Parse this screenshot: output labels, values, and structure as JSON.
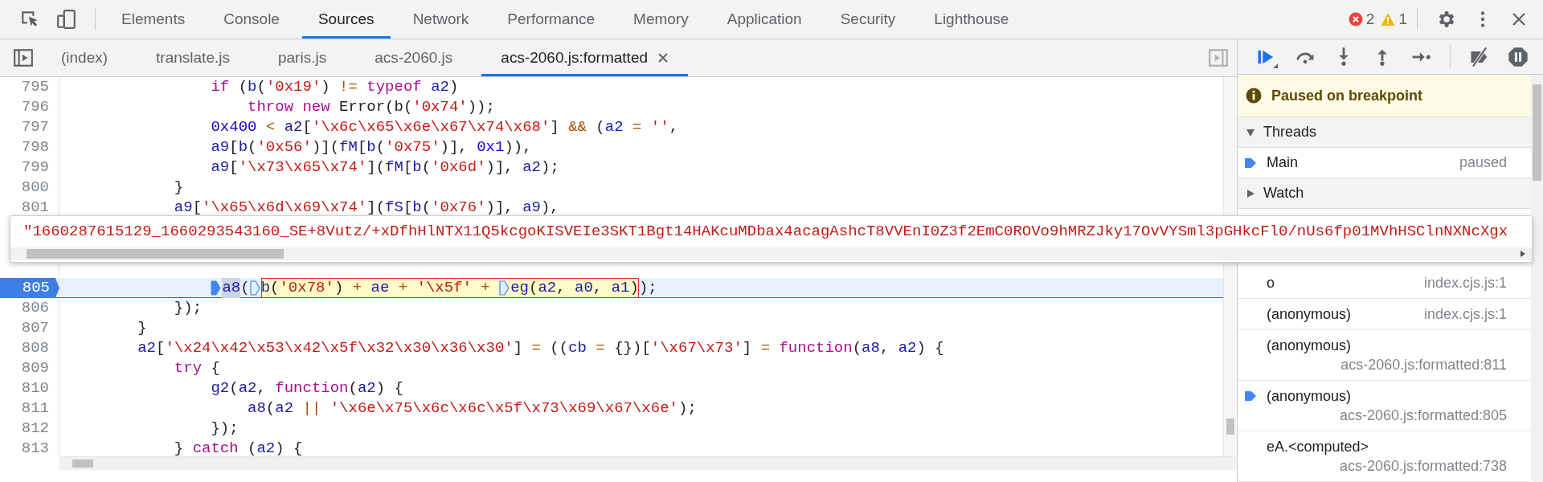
{
  "top_tabs": [
    {
      "label": "Elements",
      "selected": false
    },
    {
      "label": "Console",
      "selected": false
    },
    {
      "label": "Sources",
      "selected": true
    },
    {
      "label": "Network",
      "selected": false
    },
    {
      "label": "Performance",
      "selected": false
    },
    {
      "label": "Memory",
      "selected": false
    },
    {
      "label": "Application",
      "selected": false
    },
    {
      "label": "Security",
      "selected": false
    },
    {
      "label": "Lighthouse",
      "selected": false
    }
  ],
  "issue_counts": {
    "errors": "2",
    "warnings": "1"
  },
  "file_tabs": [
    {
      "label": "(index)",
      "selected": false,
      "closable": false
    },
    {
      "label": "translate.js",
      "selected": false,
      "closable": false
    },
    {
      "label": "paris.js",
      "selected": false,
      "closable": false
    },
    {
      "label": "acs-2060.js",
      "selected": false,
      "closable": false
    },
    {
      "label": "acs-2060.js:formatted",
      "selected": true,
      "closable": true
    }
  ],
  "code_before_popup": [
    {
      "number": "795",
      "current": false,
      "breakpoint": false,
      "tokens": [
        {
          "kind": "kw",
          "text": "                if"
        },
        {
          "kind": "p",
          "text": " ("
        },
        {
          "kind": "var",
          "text": "b"
        },
        {
          "kind": "p",
          "text": "("
        },
        {
          "kind": "str",
          "text": "'0x19'"
        },
        {
          "kind": "p",
          "text": ")"
        },
        {
          "kind": "op",
          "text": " != "
        },
        {
          "kind": "kw",
          "text": "typeof"
        },
        {
          "kind": "var",
          "text": " a2"
        },
        {
          "kind": "p",
          "text": ")"
        }
      ]
    },
    {
      "number": "796",
      "current": false,
      "breakpoint": false,
      "tokens": [
        {
          "kind": "kw",
          "text": "                    throw"
        },
        {
          "kind": "kw",
          "text": " new"
        },
        {
          "kind": "p",
          "text": " Error(b("
        },
        {
          "kind": "str",
          "text": "'0x74'"
        },
        {
          "kind": "p",
          "text": "));"
        }
      ]
    },
    {
      "number": "797",
      "current": false,
      "breakpoint": false,
      "tokens": [
        {
          "kind": "num",
          "text": "                0x400"
        },
        {
          "kind": "op",
          "text": " < "
        },
        {
          "kind": "var",
          "text": "a2"
        },
        {
          "kind": "p",
          "text": "["
        },
        {
          "kind": "str",
          "text": "'\\x6c\\x65\\x6e\\x67\\x74\\x68'"
        },
        {
          "kind": "p",
          "text": "] "
        },
        {
          "kind": "op",
          "text": "&&"
        },
        {
          "kind": "p",
          "text": " ("
        },
        {
          "kind": "var",
          "text": "a2"
        },
        {
          "kind": "op",
          "text": " = "
        },
        {
          "kind": "str",
          "text": "''"
        },
        {
          "kind": "p",
          "text": ","
        }
      ]
    },
    {
      "number": "798",
      "current": false,
      "breakpoint": false,
      "tokens": [
        {
          "kind": "var",
          "text": "                a9"
        },
        {
          "kind": "p",
          "text": "["
        },
        {
          "kind": "var",
          "text": "b"
        },
        {
          "kind": "p",
          "text": "("
        },
        {
          "kind": "str",
          "text": "'0x56'"
        },
        {
          "kind": "p",
          "text": ")]("
        },
        {
          "kind": "var",
          "text": "fM"
        },
        {
          "kind": "p",
          "text": "["
        },
        {
          "kind": "var",
          "text": "b"
        },
        {
          "kind": "p",
          "text": "("
        },
        {
          "kind": "str",
          "text": "'0x75'"
        },
        {
          "kind": "p",
          "text": ")], "
        },
        {
          "kind": "num",
          "text": "0x1"
        },
        {
          "kind": "p",
          "text": ")),"
        }
      ]
    },
    {
      "number": "799",
      "current": false,
      "breakpoint": false,
      "tokens": [
        {
          "kind": "var",
          "text": "                a9"
        },
        {
          "kind": "p",
          "text": "["
        },
        {
          "kind": "str",
          "text": "'\\x73\\x65\\x74'"
        },
        {
          "kind": "p",
          "text": "]("
        },
        {
          "kind": "var",
          "text": "fM"
        },
        {
          "kind": "p",
          "text": "["
        },
        {
          "kind": "var",
          "text": "b"
        },
        {
          "kind": "p",
          "text": "("
        },
        {
          "kind": "str",
          "text": "'0x6d'"
        },
        {
          "kind": "p",
          "text": ")], "
        },
        {
          "kind": "var",
          "text": "a2"
        },
        {
          "kind": "p",
          "text": ");"
        }
      ]
    },
    {
      "number": "800",
      "current": false,
      "breakpoint": false,
      "tokens": [
        {
          "kind": "p",
          "text": "            }"
        }
      ]
    },
    {
      "number": "801",
      "current": false,
      "breakpoint": false,
      "tokens": [
        {
          "kind": "var",
          "text": "            a9"
        },
        {
          "kind": "p",
          "text": "["
        },
        {
          "kind": "str",
          "text": "'\\x65\\x6d\\x69\\x74'"
        },
        {
          "kind": "p",
          "text": "]("
        },
        {
          "kind": "var",
          "text": "fS"
        },
        {
          "kind": "p",
          "text": "["
        },
        {
          "kind": "var",
          "text": "b"
        },
        {
          "kind": "p",
          "text": "("
        },
        {
          "kind": "str",
          "text": "'0x76'"
        },
        {
          "kind": "p",
          "text": ")], "
        },
        {
          "kind": "var",
          "text": "a9"
        },
        {
          "kind": "p",
          "text": "),"
        }
      ]
    }
  ],
  "value_popup": {
    "value": "\"1660287615129_1660293543160_SE+8Vutz/+xDfhHlNTX11Q5kcgoKISVEIe3SKT1Bgt14HAKcuMDbax4acagAshcT8VVEnI0Z3f2EmC0ROVo9hMRZJky17OvVYSml3pGHkcFl0/nUs6fp01MVhHSClnNXNcXgx"
  },
  "code_after_popup": [
    {
      "number": "805",
      "current": true,
      "breakpoint": true,
      "tokens": [
        {
          "kind": "bp",
          "active": true
        },
        {
          "kind": "var",
          "text": "                a8",
          "highlight": true
        },
        {
          "kind": "p",
          "text": "("
        },
        {
          "kind": "bp",
          "active": false
        },
        {
          "kind": "group",
          "tokens": [
            {
              "kind": "var",
              "text": "b"
            },
            {
              "kind": "p",
              "text": "("
            },
            {
              "kind": "str",
              "text": "'0x78'"
            },
            {
              "kind": "p",
              "text": ")"
            },
            {
              "kind": "op",
              "text": " + "
            },
            {
              "kind": "var",
              "text": "ae"
            },
            {
              "kind": "op",
              "text": " + "
            },
            {
              "kind": "str",
              "text": "'\\x5f'"
            },
            {
              "kind": "op",
              "text": " + "
            },
            {
              "kind": "bp",
              "active": false
            },
            {
              "kind": "var",
              "text": "eg"
            },
            {
              "kind": "p",
              "text": "("
            },
            {
              "kind": "var",
              "text": "a2"
            },
            {
              "kind": "p",
              "text": ", "
            },
            {
              "kind": "var",
              "text": "a0"
            },
            {
              "kind": "p",
              "text": ", "
            },
            {
              "kind": "var",
              "text": "a1"
            },
            {
              "kind": "p",
              "text": ")"
            }
          ]
        },
        {
          "kind": "p",
          "text": ");"
        }
      ]
    },
    {
      "number": "806",
      "current": false,
      "breakpoint": false,
      "tokens": [
        {
          "kind": "p",
          "text": "            });"
        }
      ]
    },
    {
      "number": "807",
      "current": false,
      "breakpoint": false,
      "tokens": [
        {
          "kind": "p",
          "text": "        }"
        }
      ]
    },
    {
      "number": "808",
      "current": false,
      "breakpoint": false,
      "tokens": [
        {
          "kind": "var",
          "text": "        a2"
        },
        {
          "kind": "p",
          "text": "["
        },
        {
          "kind": "str",
          "text": "'\\x24\\x42\\x53\\x42\\x5f\\x32\\x30\\x36\\x30'"
        },
        {
          "kind": "p",
          "text": "] "
        },
        {
          "kind": "op",
          "text": "="
        },
        {
          "kind": "p",
          "text": " (("
        },
        {
          "kind": "var",
          "text": "cb"
        },
        {
          "kind": "op",
          "text": " = "
        },
        {
          "kind": "p",
          "text": "{})["
        },
        {
          "kind": "str",
          "text": "'\\x67\\x73'"
        },
        {
          "kind": "p",
          "text": "] "
        },
        {
          "kind": "op",
          "text": "="
        },
        {
          "kind": "kw",
          "text": " function"
        },
        {
          "kind": "p",
          "text": "("
        },
        {
          "kind": "var",
          "text": "a8"
        },
        {
          "kind": "p",
          "text": ", "
        },
        {
          "kind": "var",
          "text": "a2"
        },
        {
          "kind": "p",
          "text": ") {"
        }
      ]
    },
    {
      "number": "809",
      "current": false,
      "breakpoint": false,
      "tokens": [
        {
          "kind": "kw",
          "text": "            try"
        },
        {
          "kind": "p",
          "text": " {"
        }
      ]
    },
    {
      "number": "810",
      "current": false,
      "breakpoint": false,
      "tokens": [
        {
          "kind": "var",
          "text": "                g2"
        },
        {
          "kind": "p",
          "text": "("
        },
        {
          "kind": "var",
          "text": "a2"
        },
        {
          "kind": "p",
          "text": ", "
        },
        {
          "kind": "kw",
          "text": "function"
        },
        {
          "kind": "p",
          "text": "("
        },
        {
          "kind": "var",
          "text": "a2"
        },
        {
          "kind": "p",
          "text": ") {"
        }
      ]
    },
    {
      "number": "811",
      "current": false,
      "breakpoint": false,
      "tokens": [
        {
          "kind": "var",
          "text": "                    a8"
        },
        {
          "kind": "p",
          "text": "("
        },
        {
          "kind": "var",
          "text": "a2"
        },
        {
          "kind": "op",
          "text": " ||"
        },
        {
          "kind": "str",
          "text": " '\\x6e\\x75\\x6c\\x6c\\x5f\\x73\\x69\\x67\\x6e'"
        },
        {
          "kind": "p",
          "text": ");"
        }
      ]
    },
    {
      "number": "812",
      "current": false,
      "breakpoint": false,
      "tokens": [
        {
          "kind": "p",
          "text": "                });"
        }
      ]
    },
    {
      "number": "813",
      "current": false,
      "breakpoint": false,
      "tokens": [
        {
          "kind": "p",
          "text": "            } "
        },
        {
          "kind": "kw",
          "text": "catch"
        },
        {
          "kind": "p",
          "text": " ("
        },
        {
          "kind": "var",
          "text": "a2"
        },
        {
          "kind": "p",
          "text": ") {"
        }
      ]
    }
  ],
  "sidebar": {
    "paused_message": "Paused on breakpoint",
    "threads": {
      "title": "Threads",
      "expanded": true,
      "items": [
        {
          "name": "Main",
          "status": "paused",
          "current": true
        }
      ]
    },
    "watch": {
      "title": "Watch",
      "expanded": false
    },
    "call_stack": [
      {
        "function": "o",
        "location": "index.cjs.js:1",
        "current": false
      },
      {
        "function": "(anonymous)",
        "location": "index.cjs.js:1",
        "current": false
      },
      {
        "function": "(anonymous)",
        "location": "acs-2060.js:formatted:811",
        "current": false
      },
      {
        "function": "(anonymous)",
        "location": "acs-2060.js:formatted:805",
        "current": true
      },
      {
        "function": "eA.<computed>",
        "location": "acs-2060.js:formatted:738",
        "current": false
      }
    ]
  }
}
